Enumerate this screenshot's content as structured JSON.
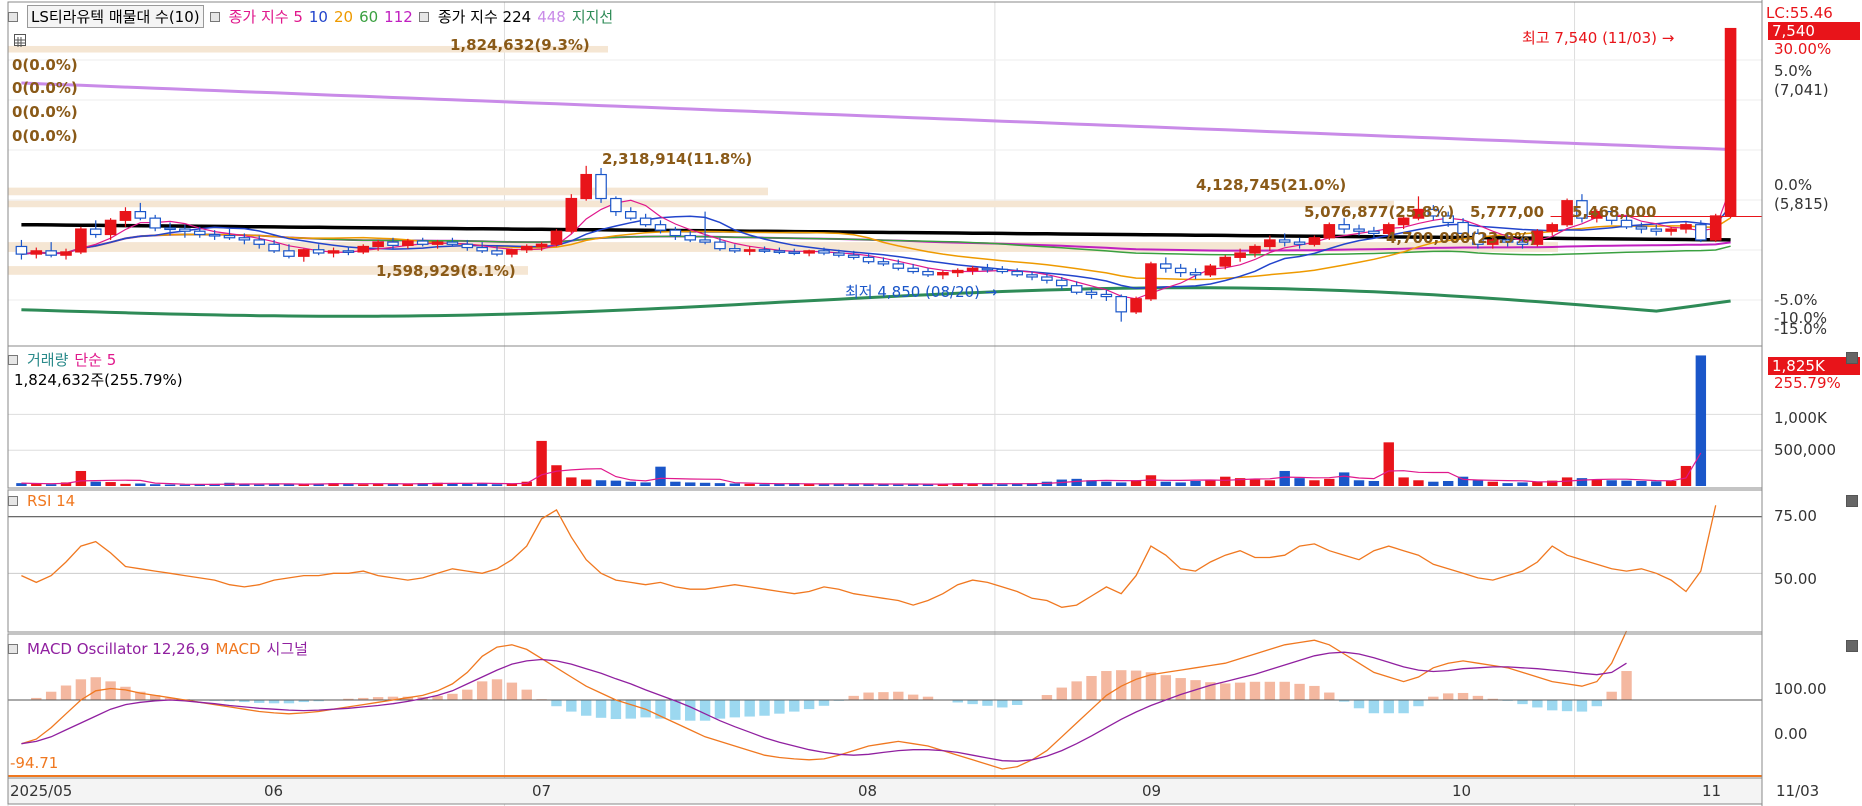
{
  "colors": {
    "up": "#e8141a",
    "down": "#1a56c9",
    "ma5": "#e0188c",
    "ma10": "#2244cc",
    "ma20": "#ee9a00",
    "ma60": "#3aa040",
    "ma112": "#c020c0",
    "ma224": "#000000",
    "ma448": "#c98be8",
    "support": "#2e8b57",
    "band": "#f5e6d3",
    "rsi": "#f07820",
    "macd": "#f07820",
    "signal": "#9020a0",
    "osc_pos": "#f4b8a0",
    "osc_neg": "#9cd8f0"
  },
  "price_panel": {
    "legend": {
      "title": "LS티라유텍 매물대 수(10)",
      "ma_label_a": "종가 지수 5",
      "ma10": "10",
      "ma20": "20",
      "ma60": "60",
      "ma112": "112",
      "ma_label_b": "종가 지수 224",
      "ma448": "448",
      "support": "지지선"
    },
    "volume_profile_labels": [
      "1,824,632(9.3%)",
      "0(0.0%)",
      "0(0.0%)",
      "0(0.0%)",
      "0(0.0%)",
      "2,318,914(11.8%)",
      "4,128,745(21.0%)",
      "5,076,877(25.8%)",
      "5,777,00",
      "5,468,000",
      "4,700,000(23.9%)",
      "1,598,929(8.1%)"
    ],
    "high_annotation": "최고 7,540 (11/03) →",
    "low_annotation": "최저 4,850 (08/20) →",
    "right_axis": {
      "lc": "LC:55.46",
      "current_price": "7,540",
      "pct_top": "30.00%",
      "pct_5": "5.0%",
      "price_5": "(7,041)",
      "pct_0": "0.0%",
      "price_0": "(5,815)",
      "pct_m5": "-5.0%",
      "pct_m10": "-10.0%",
      "pct_m15": "-15.0%"
    }
  },
  "volume_panel": {
    "legend": {
      "title": "거래량",
      "ma": "단순 5"
    },
    "current": "1,824,632주(255.79%)",
    "right_axis": {
      "current": "1,825K",
      "pct": "255.79%",
      "tick1": "1,000K",
      "tick2": "500,000"
    }
  },
  "rsi_panel": {
    "legend": "RSI 14",
    "right_axis": {
      "tick1": "75.00",
      "tick2": "50.00"
    }
  },
  "macd_panel": {
    "legend": {
      "osc": "MACD Oscillator 12,26,9",
      "macd": "MACD",
      "signal": "시그널"
    },
    "min_label": "-94.71",
    "right_axis": {
      "tick1": "100.00",
      "tick2": "0.00"
    }
  },
  "x_axis": {
    "labels": [
      "2025/05",
      "06",
      "07",
      "08",
      "09",
      "10",
      "11"
    ],
    "last_date": "11/03"
  },
  "chart_data": {
    "type": "candlestick",
    "title": "LS티라유텍",
    "x_labels": [
      "2025/05",
      "06",
      "07",
      "08",
      "09",
      "10",
      "11"
    ],
    "price_range": [
      4700,
      7600
    ],
    "high": {
      "value": 7540,
      "date": "11/03"
    },
    "low": {
      "value": 4850,
      "date": "08/20"
    },
    "candles_ohlc": [
      [
        5540,
        5600,
        5420,
        5470
      ],
      [
        5470,
        5530,
        5430,
        5500
      ],
      [
        5500,
        5580,
        5440,
        5460
      ],
      [
        5460,
        5520,
        5420,
        5490
      ],
      [
        5490,
        5720,
        5470,
        5700
      ],
      [
        5700,
        5780,
        5620,
        5650
      ],
      [
        5650,
        5800,
        5600,
        5780
      ],
      [
        5780,
        5900,
        5720,
        5860
      ],
      [
        5860,
        5940,
        5780,
        5800
      ],
      [
        5800,
        5830,
        5680,
        5710
      ],
      [
        5710,
        5760,
        5640,
        5700
      ],
      [
        5700,
        5740,
        5620,
        5680
      ],
      [
        5680,
        5720,
        5620,
        5650
      ],
      [
        5650,
        5690,
        5600,
        5640
      ],
      [
        5640,
        5700,
        5600,
        5620
      ],
      [
        5620,
        5660,
        5560,
        5600
      ],
      [
        5600,
        5640,
        5520,
        5560
      ],
      [
        5560,
        5600,
        5480,
        5500
      ],
      [
        5500,
        5560,
        5430,
        5450
      ],
      [
        5450,
        5520,
        5400,
        5510
      ],
      [
        5510,
        5560,
        5460,
        5480
      ],
      [
        5480,
        5530,
        5440,
        5500
      ],
      [
        5500,
        5540,
        5460,
        5490
      ],
      [
        5490,
        5560,
        5470,
        5540
      ],
      [
        5540,
        5600,
        5500,
        5580
      ],
      [
        5580,
        5620,
        5520,
        5550
      ],
      [
        5550,
        5610,
        5520,
        5590
      ],
      [
        5590,
        5620,
        5540,
        5560
      ],
      [
        5560,
        5600,
        5520,
        5580
      ],
      [
        5580,
        5620,
        5540,
        5560
      ],
      [
        5560,
        5600,
        5500,
        5530
      ],
      [
        5530,
        5580,
        5480,
        5500
      ],
      [
        5500,
        5540,
        5450,
        5470
      ],
      [
        5470,
        5520,
        5440,
        5510
      ],
      [
        5510,
        5560,
        5480,
        5540
      ],
      [
        5540,
        5580,
        5500,
        5560
      ],
      [
        5560,
        5700,
        5540,
        5680
      ],
      [
        5680,
        6020,
        5660,
        5980
      ],
      [
        5980,
        6280,
        5960,
        6200
      ],
      [
        6200,
        6260,
        5940,
        5980
      ],
      [
        5980,
        6000,
        5820,
        5860
      ],
      [
        5860,
        5900,
        5780,
        5800
      ],
      [
        5800,
        5840,
        5720,
        5740
      ],
      [
        5740,
        5780,
        5660,
        5690
      ],
      [
        5690,
        5720,
        5600,
        5640
      ],
      [
        5640,
        5680,
        5580,
        5600
      ],
      [
        5600,
        5860,
        5560,
        5580
      ],
      [
        5580,
        5620,
        5500,
        5520
      ],
      [
        5520,
        5560,
        5480,
        5500
      ],
      [
        5500,
        5540,
        5460,
        5510
      ],
      [
        5510,
        5540,
        5480,
        5500
      ],
      [
        5500,
        5530,
        5470,
        5490
      ],
      [
        5490,
        5520,
        5460,
        5480
      ],
      [
        5480,
        5510,
        5450,
        5500
      ],
      [
        5500,
        5530,
        5460,
        5480
      ],
      [
        5480,
        5510,
        5440,
        5460
      ],
      [
        5460,
        5500,
        5420,
        5440
      ],
      [
        5440,
        5470,
        5380,
        5400
      ],
      [
        5400,
        5440,
        5360,
        5380
      ],
      [
        5380,
        5420,
        5320,
        5340
      ],
      [
        5340,
        5380,
        5290,
        5310
      ],
      [
        5310,
        5340,
        5260,
        5280
      ],
      [
        5280,
        5320,
        5240,
        5300
      ],
      [
        5300,
        5340,
        5260,
        5320
      ],
      [
        5320,
        5360,
        5280,
        5340
      ],
      [
        5340,
        5380,
        5300,
        5330
      ],
      [
        5330,
        5360,
        5290,
        5310
      ],
      [
        5310,
        5340,
        5260,
        5280
      ],
      [
        5280,
        5310,
        5230,
        5260
      ],
      [
        5260,
        5290,
        5200,
        5230
      ],
      [
        5230,
        5260,
        5140,
        5180
      ],
      [
        5180,
        5220,
        5100,
        5120
      ],
      [
        5120,
        5160,
        5060,
        5100
      ],
      [
        5100,
        5140,
        5040,
        5080
      ],
      [
        5080,
        5100,
        4850,
        4940
      ],
      [
        4940,
        5080,
        4920,
        5060
      ],
      [
        5060,
        5400,
        5040,
        5380
      ],
      [
        5380,
        5440,
        5300,
        5340
      ],
      [
        5340,
        5380,
        5260,
        5300
      ],
      [
        5300,
        5340,
        5240,
        5280
      ],
      [
        5280,
        5380,
        5260,
        5360
      ],
      [
        5360,
        5460,
        5330,
        5440
      ],
      [
        5440,
        5520,
        5400,
        5480
      ],
      [
        5480,
        5560,
        5440,
        5540
      ],
      [
        5540,
        5640,
        5500,
        5600
      ],
      [
        5600,
        5660,
        5540,
        5580
      ],
      [
        5580,
        5620,
        5520,
        5560
      ],
      [
        5560,
        5640,
        5540,
        5620
      ],
      [
        5620,
        5760,
        5600,
        5740
      ],
      [
        5740,
        5800,
        5660,
        5700
      ],
      [
        5700,
        5740,
        5640,
        5680
      ],
      [
        5680,
        5720,
        5620,
        5660
      ],
      [
        5660,
        5760,
        5640,
        5740
      ],
      [
        5740,
        5820,
        5700,
        5800
      ],
      [
        5800,
        6000,
        5780,
        5880
      ],
      [
        5880,
        5920,
        5780,
        5820
      ],
      [
        5820,
        5860,
        5720,
        5760
      ],
      [
        5760,
        5800,
        5620,
        5660
      ],
      [
        5660,
        5700,
        5520,
        5560
      ],
      [
        5560,
        5640,
        5520,
        5600
      ],
      [
        5600,
        5660,
        5540,
        5580
      ],
      [
        5580,
        5620,
        5520,
        5560
      ],
      [
        5560,
        5700,
        5540,
        5680
      ],
      [
        5680,
        5760,
        5640,
        5740
      ],
      [
        5740,
        5980,
        5720,
        5960
      ],
      [
        5960,
        6020,
        5760,
        5800
      ],
      [
        5800,
        5880,
        5760,
        5860
      ],
      [
        5860,
        5900,
        5740,
        5780
      ],
      [
        5780,
        5820,
        5700,
        5720
      ],
      [
        5720,
        5760,
        5660,
        5700
      ],
      [
        5700,
        5740,
        5640,
        5680
      ],
      [
        5680,
        5720,
        5640,
        5700
      ],
      [
        5700,
        5760,
        5660,
        5740
      ],
      [
        5740,
        5780,
        5580,
        5600
      ],
      [
        5600,
        5840,
        5580,
        5820
      ],
      [
        5820,
        7540,
        5800,
        7540
      ]
    ],
    "volume": [
      40,
      30,
      25,
      50,
      210,
      60,
      55,
      30,
      35,
      25,
      20,
      18,
      22,
      30,
      45,
      25,
      20,
      25,
      30,
      35,
      28,
      40,
      30,
      25,
      35,
      30,
      28,
      40,
      45,
      38,
      30,
      40,
      25,
      28,
      60,
      630,
      290,
      120,
      90,
      80,
      75,
      60,
      50,
      270,
      60,
      50,
      45,
      40,
      35,
      30,
      25,
      30,
      40,
      30,
      25,
      28,
      30,
      35,
      25,
      20,
      30,
      25,
      30,
      40,
      35,
      28,
      25,
      30,
      40,
      60,
      90,
      100,
      80,
      60,
      50,
      80,
      150,
      60,
      50,
      70,
      90,
      130,
      110,
      90,
      80,
      210,
      110,
      80,
      100,
      190,
      80,
      70,
      610,
      120,
      80,
      60,
      70,
      130,
      80,
      60,
      40,
      50,
      60,
      75,
      120,
      110,
      90,
      80,
      75,
      70,
      65,
      70,
      280,
      1824
    ],
    "volume_ticks": [
      500000,
      1000000
    ],
    "rsi": [
      49,
      46,
      49,
      55,
      62,
      64,
      59,
      53,
      52,
      51,
      50,
      49,
      48,
      47,
      45,
      44,
      45,
      47,
      48,
      49,
      49,
      50,
      50,
      51,
      49,
      48,
      47,
      48,
      50,
      52,
      51,
      50,
      52,
      56,
      62,
      74,
      78,
      66,
      56,
      50,
      47,
      46,
      45,
      46,
      44,
      43,
      43,
      44,
      45,
      44,
      43,
      42,
      41,
      42,
      44,
      43,
      41,
      40,
      39,
      38,
      36,
      38,
      41,
      45,
      47,
      46,
      44,
      42,
      39,
      38,
      35,
      36,
      40,
      44,
      41,
      49,
      62,
      58,
      52,
      51,
      55,
      58,
      60,
      57,
      57,
      58,
      62,
      63,
      60,
      58,
      56,
      60,
      62,
      60,
      58,
      54,
      52,
      50,
      48,
      47,
      49,
      51,
      55,
      62,
      58,
      56,
      54,
      52,
      51,
      52,
      50,
      47,
      42,
      51,
      80
    ],
    "rsi_ticks": [
      50,
      75
    ],
    "macd": [
      -95,
      -85,
      -60,
      -30,
      0,
      20,
      25,
      22,
      15,
      10,
      5,
      0,
      -5,
      -10,
      -15,
      -20,
      -25,
      -28,
      -30,
      -28,
      -25,
      -20,
      -15,
      -10,
      -5,
      0,
      5,
      10,
      20,
      35,
      60,
      95,
      115,
      120,
      110,
      90,
      70,
      50,
      30,
      15,
      0,
      -10,
      -20,
      -35,
      -50,
      -65,
      -80,
      -90,
      -100,
      -110,
      -120,
      -125,
      -128,
      -130,
      -128,
      -120,
      -110,
      -100,
      -95,
      -90,
      -95,
      -100,
      -110,
      -120,
      -130,
      -140,
      -150,
      -145,
      -130,
      -110,
      -80,
      -50,
      -20,
      10,
      30,
      45,
      55,
      60,
      65,
      70,
      75,
      80,
      90,
      100,
      110,
      120,
      125,
      130,
      120,
      100,
      80,
      60,
      50,
      40,
      50,
      70,
      80,
      85,
      80,
      75,
      70,
      60,
      50,
      40,
      35,
      30,
      40,
      80,
      150
    ],
    "signal": [
      -95,
      -90,
      -80,
      -65,
      -50,
      -35,
      -20,
      -10,
      -5,
      -2,
      0,
      -2,
      -5,
      -8,
      -12,
      -15,
      -18,
      -20,
      -22,
      -23,
      -22,
      -20,
      -18,
      -15,
      -12,
      -8,
      -3,
      3,
      10,
      20,
      35,
      50,
      65,
      78,
      85,
      88,
      85,
      78,
      68,
      58,
      46,
      35,
      22,
      10,
      -2,
      -15,
      -30,
      -45,
      -58,
      -70,
      -82,
      -92,
      -100,
      -108,
      -114,
      -118,
      -120,
      -118,
      -114,
      -110,
      -108,
      -108,
      -110,
      -114,
      -120,
      -126,
      -132,
      -133,
      -130,
      -122,
      -110,
      -95,
      -78,
      -60,
      -42,
      -26,
      -12,
      0,
      12,
      22,
      32,
      40,
      48,
      56,
      66,
      76,
      86,
      96,
      102,
      104,
      100,
      92,
      82,
      72,
      65,
      62,
      64,
      68,
      70,
      72,
      72,
      70,
      68,
      65,
      62,
      58,
      55,
      60,
      80
    ],
    "macd_ticks": [
      0,
      100
    ]
  }
}
